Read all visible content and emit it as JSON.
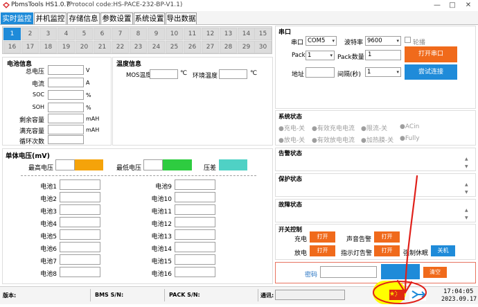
{
  "titlebar": {
    "app": "PbmsTools HS1.0.7",
    "protocol": "(Protocol code:HS-PACE-232-BP-V1.1)",
    "min_icon": "minimize-icon",
    "max_icon": "maximize-icon",
    "close_icon": "close-icon"
  },
  "tabs": [
    "实时监控",
    "并机监控",
    "存储信息",
    "参数设置",
    "系统设置",
    "导出数据"
  ],
  "cells": [
    "1",
    "2",
    "3",
    "4",
    "5",
    "6",
    "7",
    "8",
    "9",
    "10",
    "11",
    "12",
    "13",
    "14",
    "15",
    "16",
    "17",
    "18",
    "19",
    "20",
    "21",
    "22",
    "23",
    "24",
    "25",
    "26",
    "27",
    "28",
    "29",
    "30"
  ],
  "battery_info": {
    "title": "电池信息",
    "rows": [
      {
        "label": "总电压",
        "unit": "V"
      },
      {
        "label": "电流",
        "unit": "A"
      },
      {
        "label": "SOC",
        "unit": "%"
      },
      {
        "label": "SOH",
        "unit": "%"
      },
      {
        "label": "剩余容量",
        "unit": "mAH"
      },
      {
        "label": "满充容量",
        "unit": "mAH"
      },
      {
        "label": "循环次数",
        "unit": ""
      }
    ]
  },
  "temp_info": {
    "title": "温度信息",
    "mos_label": "MOS温度",
    "mos_unit": "℃",
    "env_label": "环境温度",
    "env_unit": "℃"
  },
  "cell_voltage": {
    "title": "单体电压(mV)",
    "max_label": "最高电压",
    "min_label": "最低电压",
    "diff_label": "压差",
    "max_color": "#f5a30a",
    "min_color": "#2ecc40",
    "diff_color": "#4fd1c5",
    "left": [
      "电池1",
      "电池2",
      "电池3",
      "电池4",
      "电池5",
      "电池6",
      "电池7",
      "电池8"
    ],
    "right": [
      "电池9",
      "电池10",
      "电池11",
      "电池12",
      "电池13",
      "电池14",
      "电池15",
      "电池16"
    ]
  },
  "serial": {
    "title": "串口",
    "port_label": "串口",
    "port_value": "COM5",
    "baud_label": "波特率",
    "baud_value": "9600",
    "poll_label": "轮播",
    "pack_label": "Pack",
    "pack_value": "1",
    "pack_count_label": "Pack数量",
    "pack_count_value": "1",
    "open_button": "打开串口",
    "addr_label": "地址",
    "interval_label": "间隔(秒)",
    "interval_value": "1",
    "connect_button": "尝试连接"
  },
  "system_status": {
    "title": "系统状态",
    "row1": [
      "●充电-关",
      "●有效充电电流",
      "●限流-关",
      "●ACin"
    ],
    "row2": [
      "●放电-关",
      "●有效放电电流",
      "●加热膜-关",
      "●Fully"
    ]
  },
  "alarm_status": {
    "title": "告警状态"
  },
  "protect_status": {
    "title": "保护状态"
  },
  "fault_status": {
    "title": "故障状态"
  },
  "switch_control": {
    "title": "开关控制",
    "charge_label": "充电",
    "charge_btn": "打开",
    "sound_label": "声音告警",
    "sound_btn": "打开",
    "discharge_label": "放电",
    "discharge_btn": "打开",
    "light_label": "指示灯告警",
    "light_btn": "打开",
    "sleep_label": "强制休眠",
    "sleep_btn": "关机"
  },
  "password": {
    "label": "密码",
    "clear_button": "清空"
  },
  "statusbar": {
    "version_label": "版本:",
    "bms_label": "BMS S/N:",
    "pack_label": "PACK S/N:",
    "comm_label": "通讯:",
    "time": "17:04:05",
    "date": "2023.09.17",
    "flag_icon": "china-flag-icon",
    "lang_icon": "language-switch-icon"
  },
  "annotation": {
    "highlight_color": "#ffff00",
    "circle_color": "#e0201a"
  }
}
